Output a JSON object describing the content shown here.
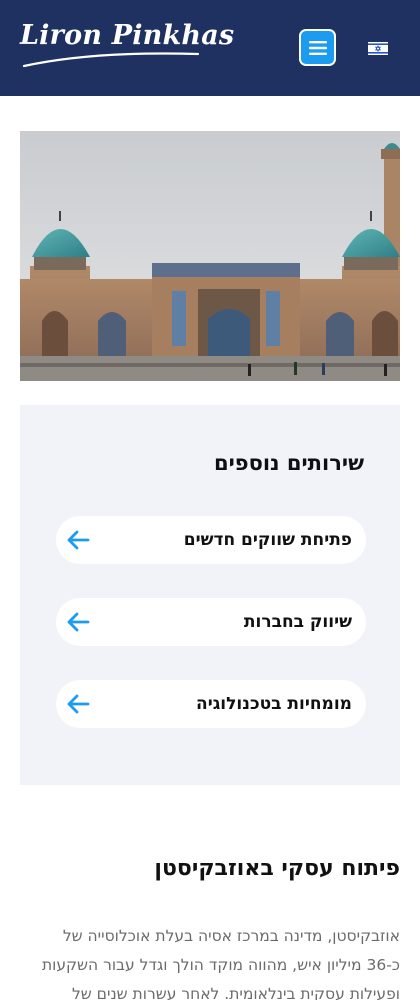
{
  "header": {
    "logo_text": "Liron Pinkhas",
    "menu_icon": "hamburger-menu-icon",
    "language_flag": "israel-flag-icon",
    "background_color": "#1f3161",
    "accent_color": "#1b9cf0"
  },
  "hero": {
    "image_subject": "Hazrati Imam complex, Tashkent — madrasa facade with two turquoise domes and a minaret"
  },
  "services": {
    "title": "שירותים נוספים",
    "items": [
      {
        "label": "פתיחת שווקים חדשים",
        "icon": "arrow-left-icon"
      },
      {
        "label": "שיווק בחברות",
        "icon": "arrow-left-icon"
      },
      {
        "label": "מומחיות בטכנולוגיה",
        "icon": "arrow-left-icon"
      }
    ],
    "background_color": "#f1f3f9"
  },
  "article": {
    "title": "פיתוח עסקי באוזבקיסטן",
    "body": "אוזבקיסטן, מדינה במרכז אסיה בעלת אוכלוסייה של כ-36 מיליון איש, מהווה מוקד הולך וגדל עבור השקעות ופעילות עסקית בינלאומית. לאחר עשרות שנים של כלכלה סגורה,"
  }
}
